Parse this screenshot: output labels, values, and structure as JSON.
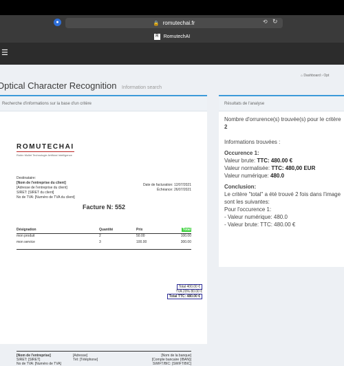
{
  "browser": {
    "url": "romutechai.fr",
    "tab_title": "RomutechAI"
  },
  "page": {
    "title": "Optical Character Recognition",
    "subtitle": "Information search",
    "breadcrumb": "Dashboard  ›  Opt"
  },
  "left_panel": {
    "header": "Recherche d'informations sur la base d'un critère"
  },
  "invoice": {
    "logo_text": "ROMUTECHAI",
    "logo_sub": "Robin Mullet Technologie Artificial Intelligence",
    "address_lines": [
      "Destinataire:",
      "[Nom de l'entreprise du client]",
      "[Adresse de l'entreprise du client]",
      "SIRET: [SIRET du client]",
      "No de TVA: [Numéro de TVA du client]"
    ],
    "date_lines": [
      "Date de facturation: 12/07/2021",
      "Échéance: 26/07/2021"
    ],
    "title": "Facture N: 552",
    "headers": [
      "Désignation",
      "Quantité",
      "Prix",
      "Total"
    ],
    "rows": [
      [
        "mon produit",
        "2",
        "50.00",
        "100.00"
      ],
      [
        "mon service",
        "3",
        "100.00",
        "300.00"
      ]
    ],
    "totals": [
      "Total 400.00 €",
      "TVA 20% 80.00 €",
      "Total TTC: 480.00 €"
    ],
    "footer_left": [
      "[Nom de l'entreprise]",
      "SIRET: [SIRET]",
      "No de TVA: [Numéro de TVA]"
    ],
    "footer_mid": [
      "[Adresse]",
      "Tél: [Téléphone]"
    ],
    "footer_right": [
      "[Nom de la banque]",
      "[Compte bancaire (IBAN)]",
      "SWIFT/BIC: [SWIFT/BIC]"
    ]
  },
  "right_panel": {
    "header": "Résultats de l'analyse",
    "count_label": "Nombre d'orrurence(s) trouvée(s) pour le critère",
    "count_value": "2",
    "found_label": "Informations trouvées :",
    "occurrence_title": "Occurence 1:",
    "gross_label": "Valeur brute:",
    "gross_value": "TTC: 480.00 €",
    "normalized_label": "Valeur normalisée:",
    "normalized_value": "TTC: 480,00 EUR",
    "numeric_label": "Valeur numérique:",
    "numeric_value": "480.0",
    "conclusion_title": "Conclusion:",
    "conclusion_1": "Le critère \"total\" a été trouvé 2 fois dans l'image",
    "conclusion_2": "sont les suivantes:",
    "conclusion_3": "Pour l'occurence 1:",
    "conclusion_4": "- Valeur numérique: 480.0",
    "conclusion_5": "- Valeur brute: TTC: 480.00 €"
  }
}
